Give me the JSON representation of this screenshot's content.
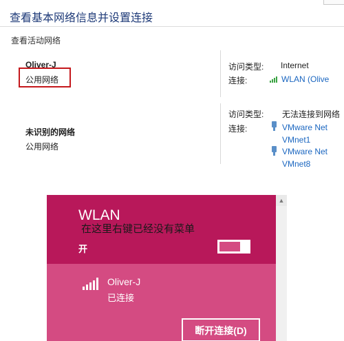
{
  "window": {
    "title": "查看基本网络信息并设置连接"
  },
  "active_networks": {
    "section_label": "查看活动网络",
    "networks": [
      {
        "name": "Oliver-J",
        "category": "公用网络",
        "access_type_label": "访问类型:",
        "access_type": "Internet",
        "connection_label": "连接:",
        "connections": [
          "WLAN (Olive"
        ]
      },
      {
        "name": "未识别的网络",
        "category": "公用网络",
        "access_type_label": "访问类型:",
        "access_type": "无法连接到网络",
        "connection_label": "连接:",
        "connections": [
          "VMware Net",
          "VMnet1",
          "VMware Net",
          "VMnet8"
        ]
      }
    ]
  },
  "wlan_flyout": {
    "title": "WLAN",
    "annotation": "在这里右键已经没有菜单",
    "toggle_label": "开",
    "toggle_state": "on",
    "network_name": "Oliver-J",
    "network_status": "已连接",
    "disconnect_button": "断开连接(D)",
    "colors": {
      "header_bg": "#b8185a",
      "item_bg": "#d44b82",
      "highlight_box": "#c4171b",
      "link": "#1a66c0"
    }
  },
  "icons": {
    "wifi_signal": "wifi-signal-icon",
    "ethernet": "ethernet-adapter-icon",
    "scroll_up": "chevron-up-icon"
  }
}
